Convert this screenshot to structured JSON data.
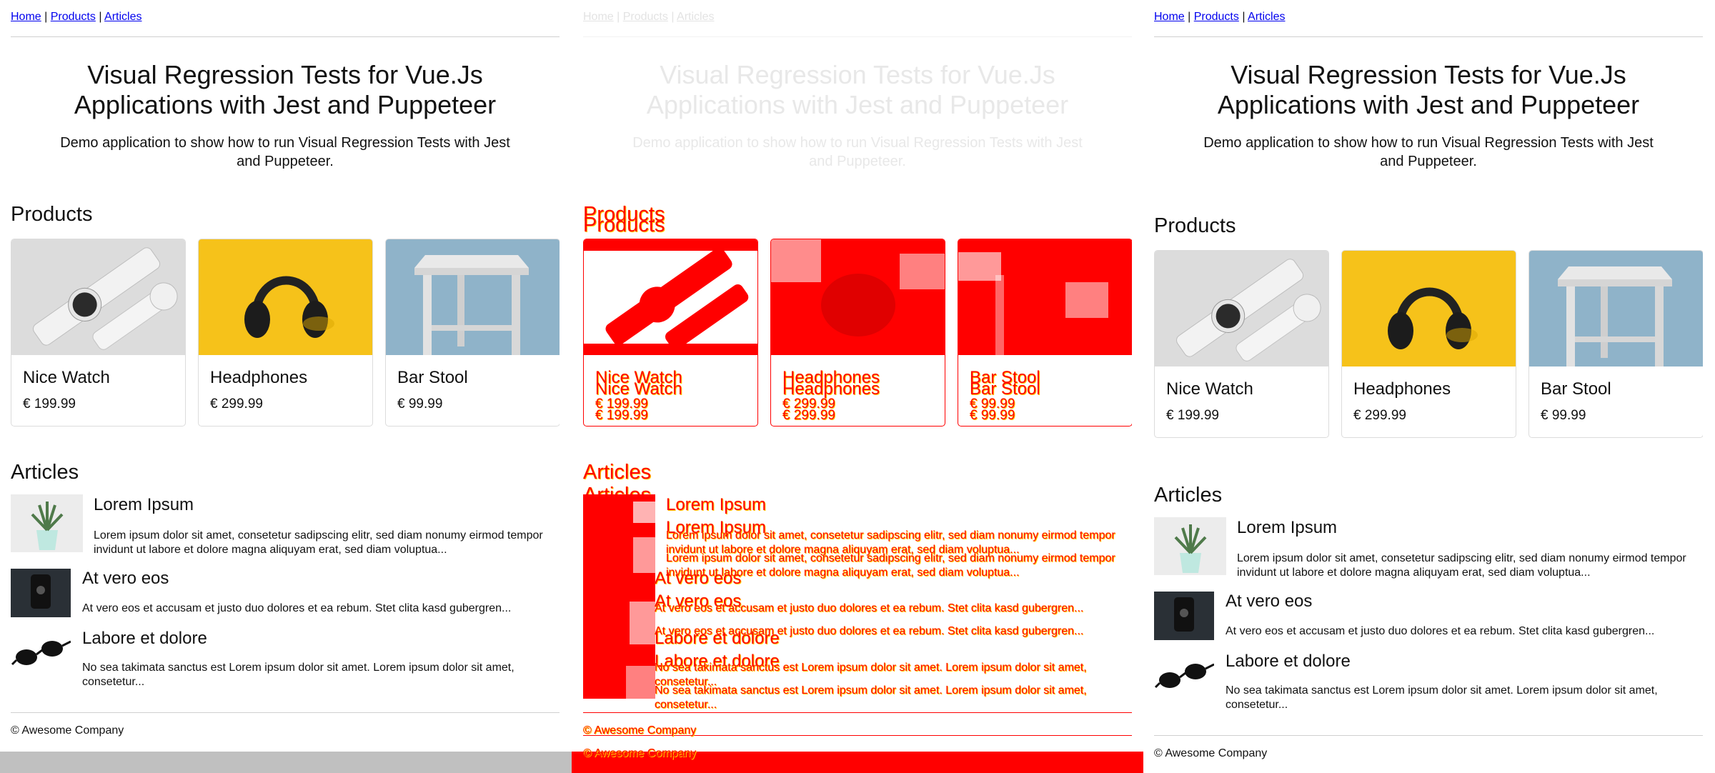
{
  "nav": {
    "home": "Home",
    "products": "Products",
    "articles": "Articles",
    "sep": " | "
  },
  "hero": {
    "title_line1": "Visual Regression Tests for Vue.Js",
    "title_line2": "Applications with Jest and Puppeteer",
    "subtitle": "Demo application to show how to run Visual Regression Tests with Jest and Puppeteer."
  },
  "products_heading": "Products",
  "products": [
    {
      "name": "Nice Watch",
      "price": "€ 199.99",
      "image": "watch-image"
    },
    {
      "name": "Headphones",
      "price": "€ 299.99",
      "image": "headphones-image"
    },
    {
      "name": "Bar Stool",
      "price": "€ 99.99",
      "image": "stool-image"
    }
  ],
  "articles_heading": "Articles",
  "articles": [
    {
      "title": "Lorem Ipsum",
      "text": "Lorem ipsum dolor sit amet, consetetur sadipscing elitr, sed diam nonumy eirmod tempor invidunt ut labore et dolore magna aliquyam erat, sed diam voluptua...",
      "image": "plant-image"
    },
    {
      "title": "At vero eos",
      "text": "At vero eos et accusam et justo duo dolores et ea rebum. Stet clita kasd gubergren...",
      "image": "dark-object-image"
    },
    {
      "title": "Labore et dolore",
      "text": "No sea takimata sanctus est Lorem ipsum dolor sit amet. Lorem ipsum dolor sit amet, consetetur...",
      "image": "sunglasses-image"
    }
  ],
  "footer": "© Awesome Company",
  "colors": {
    "diff_red": "#ff0000",
    "diff_yellow": "#ffd700",
    "link": "#0000ee",
    "bottom_bar_left": "#c0c0c0"
  }
}
